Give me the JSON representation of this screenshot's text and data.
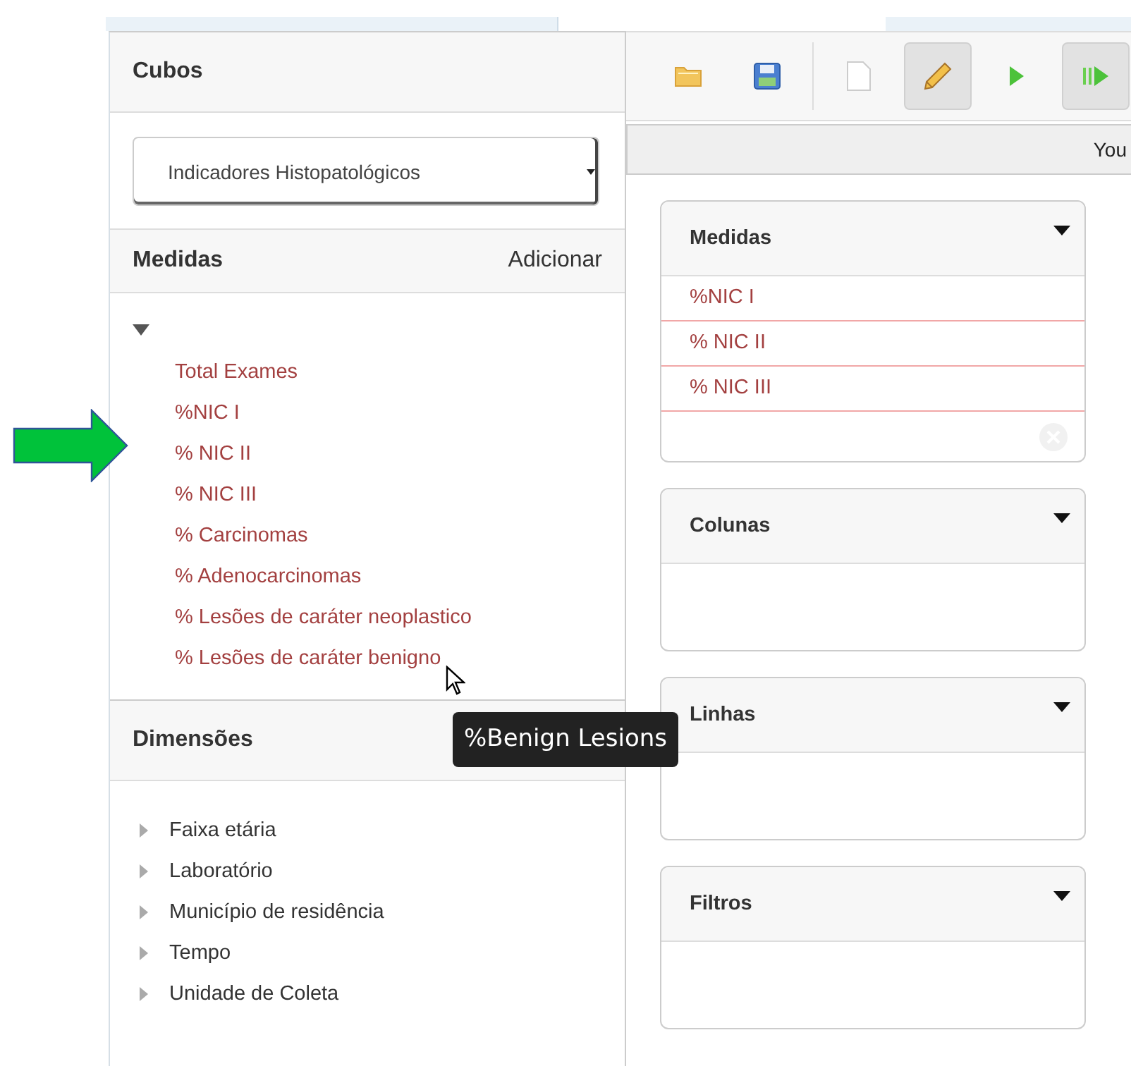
{
  "cubes": {
    "title": "Cubos",
    "selected_cube": "Indicadores Histopatológicos"
  },
  "measures": {
    "title": "Medidas",
    "add_link": "Adicionar",
    "expanded": true,
    "items": [
      {
        "label": "Total Exames"
      },
      {
        "label": "%NIC I"
      },
      {
        "label": "% NIC II"
      },
      {
        "label": "% NIC III"
      },
      {
        "label": "% Carcinomas"
      },
      {
        "label": "% Adenocarcinomas"
      },
      {
        "label": "% Lesões de caráter neoplastico"
      },
      {
        "label": "% Lesões de caráter benigno"
      }
    ]
  },
  "dimensions": {
    "title": "Dimensões",
    "items": [
      {
        "label": "Faixa etária",
        "expanded": false
      },
      {
        "label": "Laboratório",
        "expanded": false
      },
      {
        "label": "Município de residência",
        "expanded": false
      },
      {
        "label": "Tempo",
        "expanded": false
      },
      {
        "label": "Unidade de Coleta",
        "expanded": false
      }
    ]
  },
  "toolbar": {
    "buttons": [
      {
        "kind": "open",
        "pressed": false
      },
      {
        "kind": "save",
        "pressed": false
      },
      {
        "kind": "new",
        "pressed": false
      },
      {
        "kind": "edit",
        "pressed": true
      },
      {
        "kind": "run",
        "pressed": false
      },
      {
        "kind": "auto-run",
        "pressed": true
      }
    ]
  },
  "message_bar": {
    "text": "You"
  },
  "drop_zones": [
    {
      "title": "Medidas",
      "items": [
        "%NIC I",
        "% NIC II",
        "% NIC III"
      ],
      "clear_button": true
    },
    {
      "title": "Colunas",
      "clear_button": false
    },
    {
      "title": "Linhas",
      "clear_button": false
    },
    {
      "title": "Filtros",
      "clear_button": false
    }
  ],
  "tooltip": {
    "text": "%Benign Lesions"
  }
}
